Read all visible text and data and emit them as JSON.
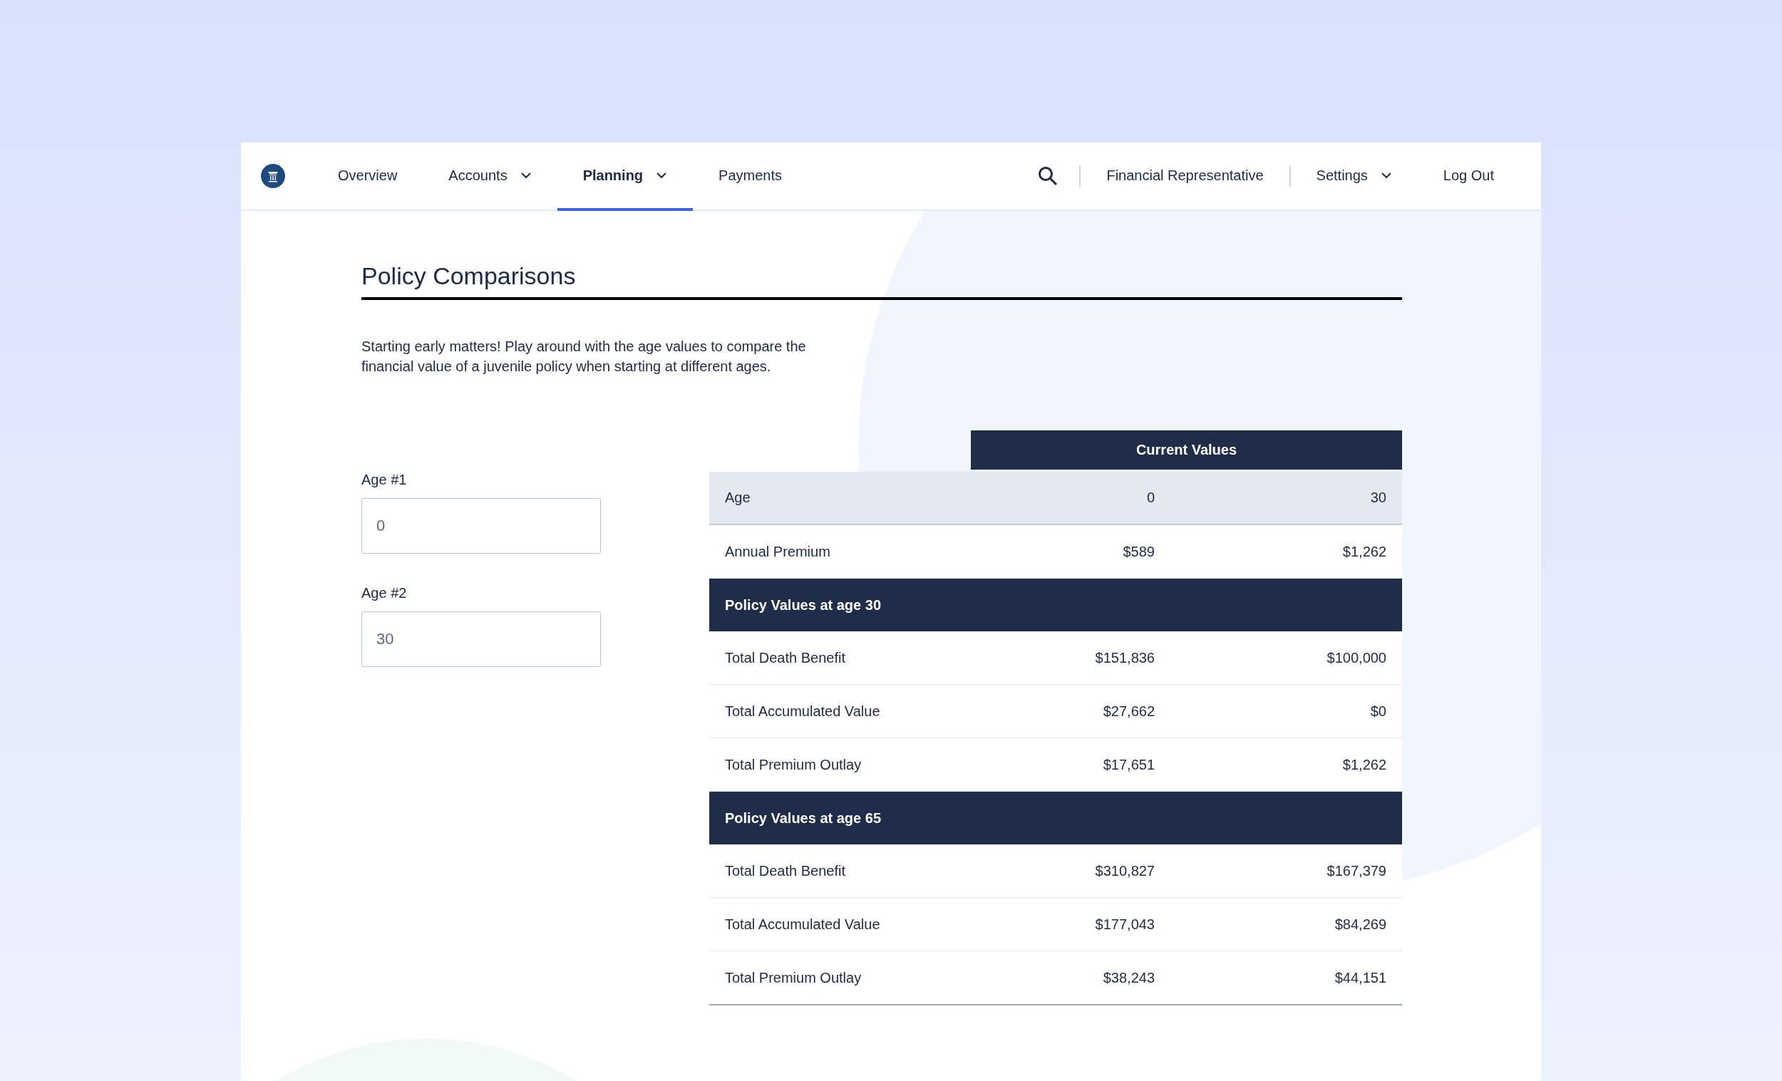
{
  "nav": {
    "items": [
      {
        "label": "Overview",
        "dropdown": false,
        "selected": false
      },
      {
        "label": "Accounts",
        "dropdown": true,
        "selected": false
      },
      {
        "label": "Planning",
        "dropdown": true,
        "selected": true
      },
      {
        "label": "Payments",
        "dropdown": false,
        "selected": false
      }
    ],
    "utility": [
      {
        "label": "Financial Representative",
        "dropdown": false
      },
      {
        "label": "Settings",
        "dropdown": true
      },
      {
        "label": "Log Out",
        "dropdown": false
      }
    ]
  },
  "page": {
    "title": "Policy Comparisons",
    "intro": "Starting early matters! Play around with the age values to compare the financial value of a juvenile policy when starting at different ages.",
    "fields": [
      {
        "label": "Age #1",
        "value": "0"
      },
      {
        "label": "Age #2",
        "value": "30"
      }
    ],
    "table": {
      "header": "Current Values",
      "rows": [
        {
          "kind": "head",
          "label": "Age",
          "values": [
            "0",
            "30"
          ]
        },
        {
          "kind": "data",
          "label": "Annual Premium",
          "values": [
            "$589",
            "$1,262"
          ]
        },
        {
          "kind": "section",
          "label": "Policy Values at age 30"
        },
        {
          "kind": "data",
          "label": "Total Death Benefit",
          "values": [
            "$151,836",
            "$100,000"
          ]
        },
        {
          "kind": "data",
          "label": "Total Accumulated Value",
          "values": [
            "$27,662",
            "$0"
          ]
        },
        {
          "kind": "data",
          "label": "Total Premium Outlay",
          "values": [
            "$17,651",
            "$1,262"
          ]
        },
        {
          "kind": "section",
          "label": "Policy Values at age 65"
        },
        {
          "kind": "data",
          "label": "Total Death Benefit",
          "values": [
            "$310,827",
            "$167,379"
          ]
        },
        {
          "kind": "data",
          "label": "Total Accumulated Value",
          "values": [
            "$177,043",
            "$84,269"
          ]
        },
        {
          "kind": "data",
          "label": "Total Premium Outlay",
          "values": [
            "$38,243",
            "$44,151"
          ]
        }
      ]
    }
  }
}
